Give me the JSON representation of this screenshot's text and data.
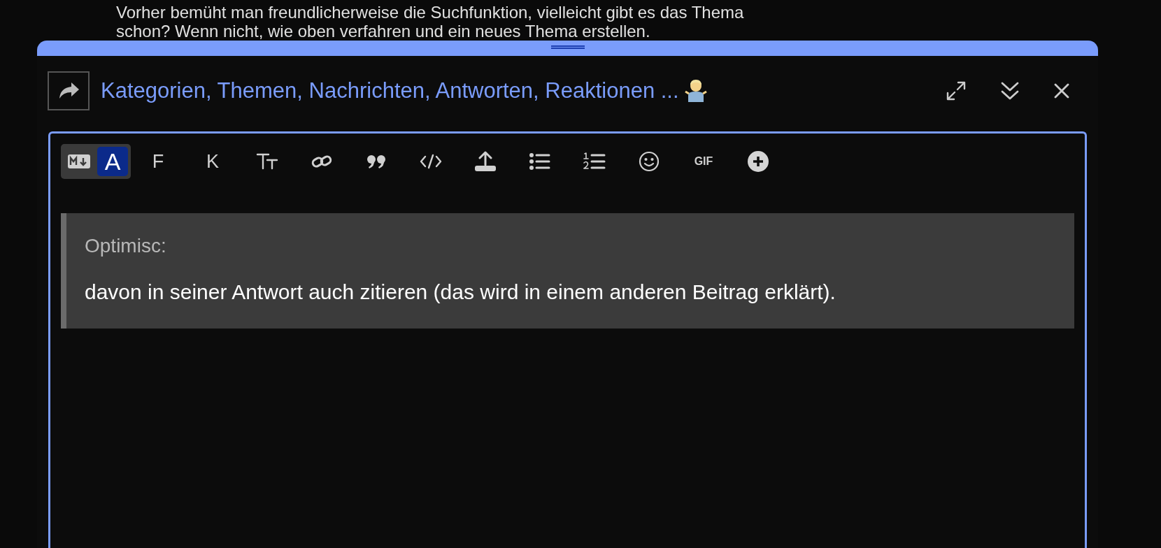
{
  "background_text": [
    "Vorher bemüht man freundlicherweise die Suchfunktion, vielleicht gibt es das Thema",
    "schon? Wenn nicht, wie oben verfahren und ein neues Thema erstellen."
  ],
  "composer": {
    "title": "Kategorien, Themen, Nachrichten, Antworten, Reaktionen ...",
    "mode_toggle": [
      {
        "kind": "markdown",
        "selected": false
      },
      {
        "kind": "rich",
        "label": "A",
        "selected": true
      }
    ],
    "toolbar": [
      {
        "kind": "text",
        "label": "F"
      },
      {
        "kind": "text",
        "label": "K"
      },
      {
        "kind": "heading"
      },
      {
        "kind": "link"
      },
      {
        "kind": "quote"
      },
      {
        "kind": "code"
      },
      {
        "kind": "upload"
      },
      {
        "kind": "bullets"
      },
      {
        "kind": "numbered"
      },
      {
        "kind": "emoji"
      },
      {
        "kind": "gif",
        "label": "GIF"
      },
      {
        "kind": "more"
      }
    ],
    "quote": {
      "author": "Optimisc:",
      "text": "davon in seiner Antwort auch zitieren (das wird in einem anderen Beitrag erklärt)."
    }
  }
}
